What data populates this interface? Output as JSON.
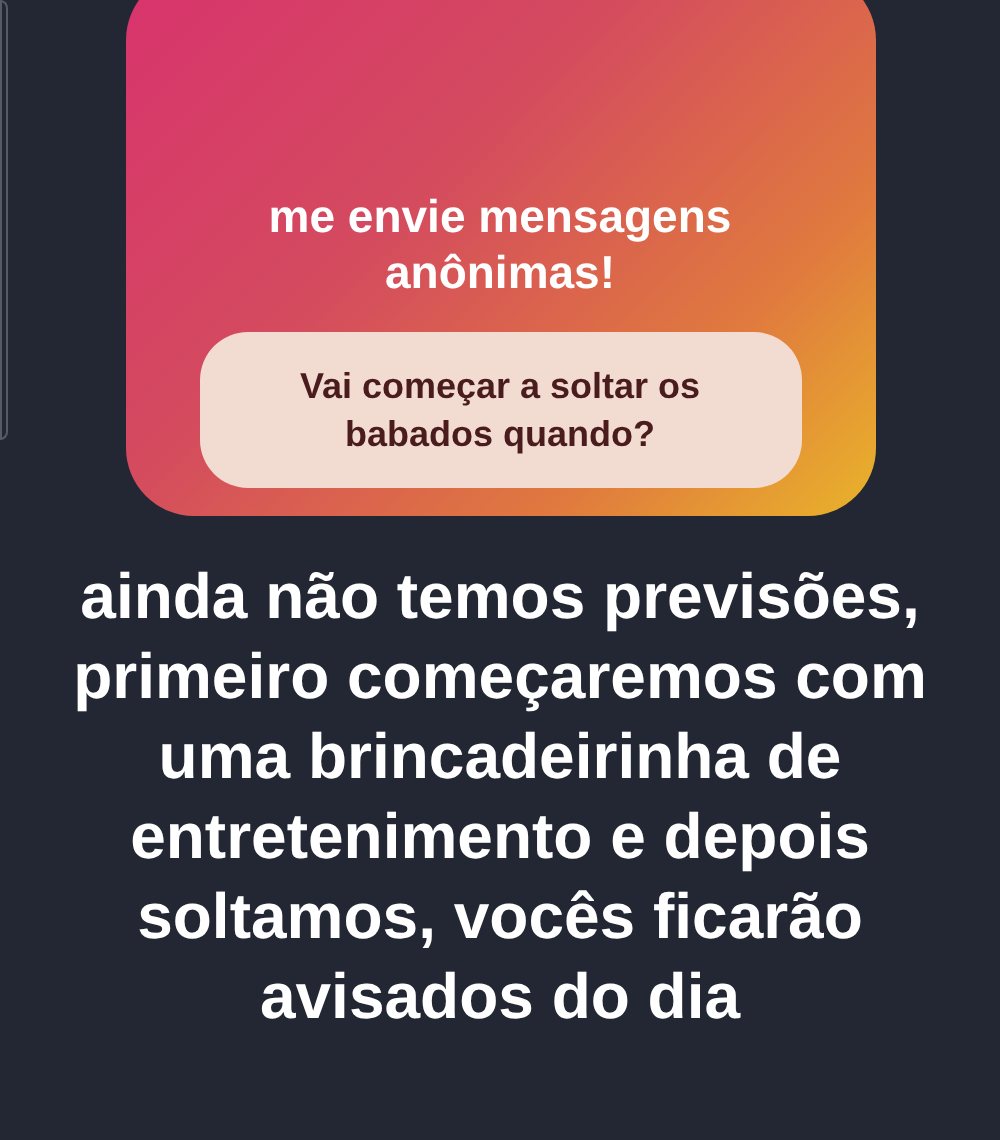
{
  "question_sticker": {
    "title": "me envie mensagens anônimas!",
    "question": "Vai começar a soltar os babados quando?"
  },
  "answer": "ainda não temos previsões, primeiro começaremos com uma brincadeirinha de entretenimento e depois soltamos, vocês ficarão avisados do dia"
}
